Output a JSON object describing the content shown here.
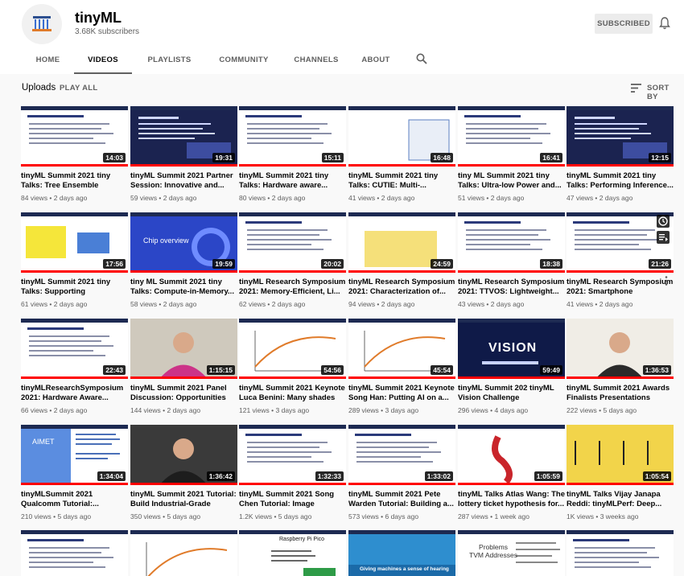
{
  "channel": {
    "name": "tinyML",
    "subscribers": "3.68K subscribers",
    "subscribed_label": "SUBSCRIBED"
  },
  "tabs": [
    {
      "label": "HOME"
    },
    {
      "label": "VIDEOS"
    },
    {
      "label": "PLAYLISTS"
    },
    {
      "label": "COMMUNITY"
    },
    {
      "label": "CHANNELS"
    },
    {
      "label": "ABOUT"
    }
  ],
  "uploads": {
    "title": "Uploads",
    "play_all": "PLAY ALL",
    "sort_by": "SORT BY"
  },
  "colors": {
    "accent": "#ff0000",
    "slide_header": "#1d2a52"
  },
  "icons": {
    "bell": "bell-icon",
    "search": "search-icon",
    "sort": "sort-icon",
    "clock": "clock-icon",
    "queue": "queue-icon",
    "more": "more-vert-icon"
  },
  "videos": [
    {
      "title": "tinyML Summit 2021 tiny\nTalks: Tree Ensemble Model...",
      "meta": "84 views • 2 days ago",
      "duration": "14:03",
      "style": "tree"
    },
    {
      "title": "tinyML Summit 2021 Partner\nSession: Innovative and...",
      "meta": "59 views • 2 days ago",
      "duration": "19:31",
      "style": "dark"
    },
    {
      "title": "tinyML Summit 2021 tiny\nTalks: Hardware aware...",
      "meta": "80 views • 2 days ago",
      "duration": "15:11",
      "style": "cubes"
    },
    {
      "title": "tinyML Summit 2021 tiny\nTalks: CUTIE: Multi-...",
      "meta": "41 views • 2 days ago",
      "duration": "16:48",
      "style": "arch"
    },
    {
      "title": "tiny ML Summit 2021 tiny\nTalks: Ultra-low Power and...",
      "meta": "51 views • 2 days ago",
      "duration": "16:41",
      "style": "text"
    },
    {
      "title": "tinyML Summit 2021 tiny\nTalks: Performing Inference...",
      "meta": "47 views • 2 days ago",
      "duration": "12:15",
      "style": "dark"
    },
    {
      "title": "tinyML Summit 2021 tiny\nTalks: Supporting Tensorflo...",
      "meta": "61 views • 2 days ago",
      "duration": "17:56",
      "style": "blocks"
    },
    {
      "title": "tiny ML Summit 2021 tiny\nTalks: Compute-in-Memory...",
      "meta": "58 views • 2 days ago",
      "duration": "19:59",
      "style": "circle"
    },
    {
      "title": "tinyML Research Symposium\n2021: Memory-Efficient, Li...",
      "meta": "62 views • 2 days ago",
      "duration": "20:02",
      "style": "flow"
    },
    {
      "title": "tinyML Research Symposium\n2021: Characterization of...",
      "meta": "94 views • 2 days ago",
      "duration": "24:59",
      "style": "yellow"
    },
    {
      "title": "tinyML Research Symposium\n2021: TTVOS: Lightweight...",
      "meta": "43 views • 2 days ago",
      "duration": "18:38",
      "style": "grid"
    },
    {
      "title": "tinyML Research Symposium\n2021: Smartphone Impostor...",
      "meta": "41 views • 2 days ago",
      "duration": "21:26",
      "style": "text"
    },
    {
      "title": "tinyMLResearchSymposium\n2021: Hardware Aware...",
      "meta": "66 views • 2 days ago",
      "duration": "22:43",
      "style": "text"
    },
    {
      "title": "tinyML Summit 2021 Panel\nDiscussion: Opportunities a...",
      "meta": "144 views • 2 days ago",
      "duration": "1:15:15",
      "style": "person"
    },
    {
      "title": "tinyML Summit 2021 Keynote\nLuca Benini: Many shades o...",
      "meta": "121 views • 3 days ago",
      "duration": "54:56",
      "style": "plot"
    },
    {
      "title": "tinyML Summit 2021 Keynote\nSong Han: Putting AI on a...",
      "meta": "289 views • 3 days ago",
      "duration": "45:54",
      "style": "bars"
    },
    {
      "title": "tinyML Summit 202 tinyML\nVision Challenge",
      "meta": "296 views • 4 days ago",
      "duration": "59:49",
      "style": "vision"
    },
    {
      "title": "tinyML Summit 2021 Awards\nFinalists Presentations",
      "meta": "222 views • 5 days ago",
      "duration": "1:36:53",
      "style": "person2"
    },
    {
      "title": "tinyMLSummit 2021\nQualcomm Tutorial:...",
      "meta": "210 views • 5 days ago",
      "duration": "1:34:04",
      "style": "aimet"
    },
    {
      "title": "tinyML Summit 2021 Tutorial:\nBuild Industrial-Grade tinyM...",
      "meta": "350 views • 5 days ago",
      "duration": "1:36:42",
      "style": "person3"
    },
    {
      "title": "tinyML Summit 2021 Song\nChen Tutorial: Image sensor...",
      "meta": "1.2K views • 5 days ago",
      "duration": "1:32:33",
      "style": "circuit"
    },
    {
      "title": "tinyML Summit 2021 Pete\nWarden Tutorial: Building a...",
      "meta": "573 views • 6 days ago",
      "duration": "1:33:02",
      "style": "text"
    },
    {
      "title": "tinyML Talks Atlas Wang: The\nlottery ticket hypothesis for...",
      "meta": "287 views • 1 week ago",
      "duration": "1:05:59",
      "style": "lottery"
    },
    {
      "title": "tinyML Talks Vijay Janapa\nReddi: tinyMLPerf: Deep...",
      "meta": "1K views • 3 weeks ago",
      "duration": "1:05:54",
      "style": "ruler"
    },
    {
      "title": "",
      "meta": "",
      "duration": "",
      "style": "text"
    },
    {
      "title": "",
      "meta": "",
      "duration": "",
      "style": "scatter"
    },
    {
      "title": "",
      "meta": "",
      "duration": "",
      "style": "pico"
    },
    {
      "title": "",
      "meta": "",
      "duration": "",
      "style": "hearing"
    },
    {
      "title": "",
      "meta": "",
      "duration": "",
      "style": "tvm"
    },
    {
      "title": "",
      "meta": "",
      "duration": "",
      "style": "text"
    }
  ],
  "thumb_texts": {
    "circle": "Chip overview",
    "vision": "VISION",
    "aimet": "AIMET",
    "hearing": "Giving machines a sense of hearing",
    "tvm": "Problems\nTVM Addresses",
    "pico": "Raspberry Pi Pico"
  }
}
